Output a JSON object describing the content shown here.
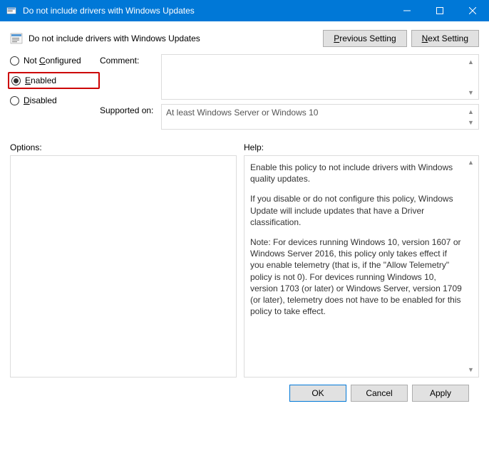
{
  "window": {
    "title": "Do not include drivers with Windows Updates"
  },
  "header": {
    "title": "Do not include drivers with Windows Updates"
  },
  "nav": {
    "prev": "Previous Setting",
    "next": "Next Setting",
    "prev_ul": "P",
    "next_ul": "N"
  },
  "radios": {
    "not_configured": "Not Configured",
    "enabled": "Enabled",
    "disabled": "Disabled",
    "selected": "enabled"
  },
  "fields": {
    "comment_label": "Comment:",
    "comment_value": "",
    "supported_label": "Supported on:",
    "supported_value": "At least Windows Server or Windows 10"
  },
  "lower": {
    "options_label": "Options:",
    "help_label": "Help:"
  },
  "help": {
    "p1": "Enable this policy to not include drivers with Windows quality updates.",
    "p2": "If you disable or do not configure this policy, Windows Update will include updates that have a Driver classification.",
    "p3": "Note: For devices running Windows 10, version 1607 or Windows Server 2016, this policy only takes effect if you enable telemetry (that is, if the \"Allow Telemetry\" policy is not 0). For devices running Windows 10, version 1703 (or later) or Windows Server, version 1709 (or later), telemetry does not have to be enabled for this policy to take effect."
  },
  "footer": {
    "ok": "OK",
    "cancel": "Cancel",
    "apply": "Apply"
  }
}
